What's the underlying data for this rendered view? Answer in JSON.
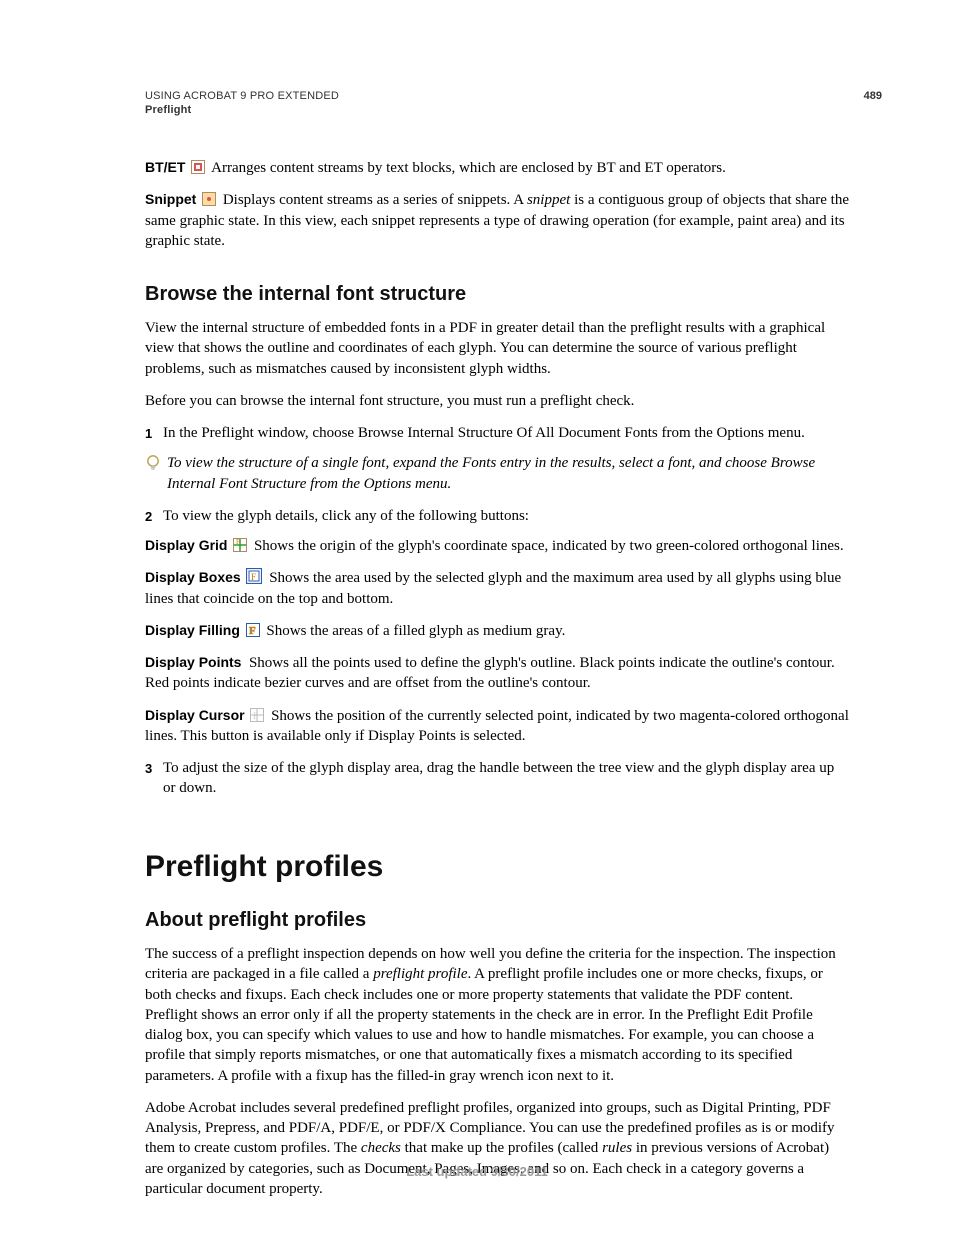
{
  "header": {
    "line1": "USING ACROBAT 9 PRO EXTENDED",
    "line2": "Preflight",
    "page_number": "489"
  },
  "btet": {
    "label": "BT/ET",
    "text": "Arranges content streams by text blocks, which are enclosed by BT and ET operators."
  },
  "snippet": {
    "label": "Snippet",
    "lead": "Displays content streams as a series of snippets. A ",
    "italic": "snippet",
    "tail": " is a contiguous group of objects that share the same graphic state. In this view, each snippet represents a type of drawing operation (for example, paint area) and its graphic state."
  },
  "browse": {
    "heading": "Browse the internal font structure",
    "p1": "View the internal structure of embedded fonts in a PDF in greater detail than the preflight results with a graphical view that shows the outline and coordinates of each glyph. You can determine the source of various preflight problems, such as mismatches caused by inconsistent glyph widths.",
    "p2": "Before you can browse the internal font structure, you must run a preflight check.",
    "step1_num": "1",
    "step1": "In the Preflight window, choose Browse Internal Structure Of All Document Fonts from the Options menu.",
    "tip": "To view the structure of a single font, expand the Fonts entry in the results, select a font, and choose Browse Internal Font Structure from the Options menu.",
    "step2_num": "2",
    "step2": "To view the glyph details, click any of the following buttons:",
    "display_grid_label": "Display Grid",
    "display_grid_text": "Shows the origin of the glyph's coordinate space, indicated by two green-colored orthogonal lines.",
    "display_boxes_label": "Display Boxes",
    "display_boxes_text": "Shows the area used by the selected glyph and the maximum area used by all glyphs using blue lines that coincide on the top and bottom.",
    "display_filling_label": "Display Filling",
    "display_filling_text": "Shows the areas of a filled glyph as medium gray.",
    "display_points_label": "Display Points",
    "display_points_text": "Shows all the points used to define the glyph's outline. Black points indicate the outline's contour. Red points indicate bezier curves and are offset from the outline's contour.",
    "display_cursor_label": "Display Cursor",
    "display_cursor_text": "Shows the position of the currently selected point, indicated by two magenta-colored orthogonal lines. This button is available only if Display Points is selected.",
    "step3_num": "3",
    "step3": "To adjust the size of the glyph display area, drag the handle between the tree view and the glyph display area up or down."
  },
  "profiles": {
    "heading": "Preflight profiles",
    "sub": "About preflight profiles",
    "p1_lead": "The success of a preflight inspection depends on how well you define the criteria for the inspection. The inspection criteria are packaged in a file called a ",
    "p1_italic": "preflight profile",
    "p1_tail": ". A preflight profile includes one or more checks, fixups, or both checks and fixups. Each check includes one or more property statements that validate the PDF content. Preflight shows an error only if all the property statements in the check are in error. In the Preflight Edit Profile dialog box, you can specify which values to use and how to handle mismatches. For example, you can choose a profile that simply reports mismatches, or one that automatically fixes a mismatch according to its specified parameters. A profile with a fixup has the filled-in gray wrench icon next to it.",
    "p2_a": "Adobe Acrobat includes several predefined preflight profiles, organized into groups, such as Digital Printing, PDF Analysis, Prepress, and PDF/A, PDF/E, or PDF/X Compliance. You can use the predefined profiles as is or modify them to create custom profiles. The ",
    "p2_checks": "checks",
    "p2_b": " that make up the profiles (called ",
    "p2_rules": "rules",
    "p2_c": " in previous versions of Acrobat) are organized by categories, such as Document, Pages, Images, and so on. Each check in a category governs a particular document property."
  },
  "footer": "Last updated 9/30/2011"
}
